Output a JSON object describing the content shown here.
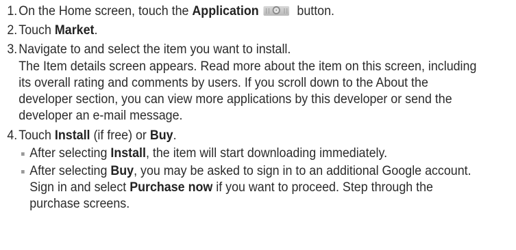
{
  "steps": [
    {
      "num": "1.",
      "pre": "On the Home screen, touch the ",
      "bold": "Application",
      "post": " button."
    },
    {
      "num": "2.",
      "pre": "Touch ",
      "bold": "Market",
      "post": "."
    },
    {
      "num": "3.",
      "line1": "Navigate to and select the item you want to install.",
      "detail": "The Item details screen appears. Read more about the item on this screen, including its overall rating and comments by users. If you scroll down to the About the developer section, you can view more applications by this developer or send the developer an e-mail message."
    },
    {
      "num": "4.",
      "pre": "Touch ",
      "bold1": "Install",
      "mid": " (if free) or ",
      "bold2": "Buy",
      "post": "."
    }
  ],
  "bullets": [
    {
      "pre": "After selecting ",
      "bold": "Install",
      "post": ", the item will start downloading immediately."
    },
    {
      "pre": "After selecting ",
      "bold": "Buy",
      "mid": ", you may be asked to sign in to an additional Google account. Sign in and select ",
      "bold2": "Purchase now",
      "post": " if you want to proceed. Step through the purchase screens."
    }
  ],
  "icons": {
    "application_button": "application-launcher-icon"
  }
}
